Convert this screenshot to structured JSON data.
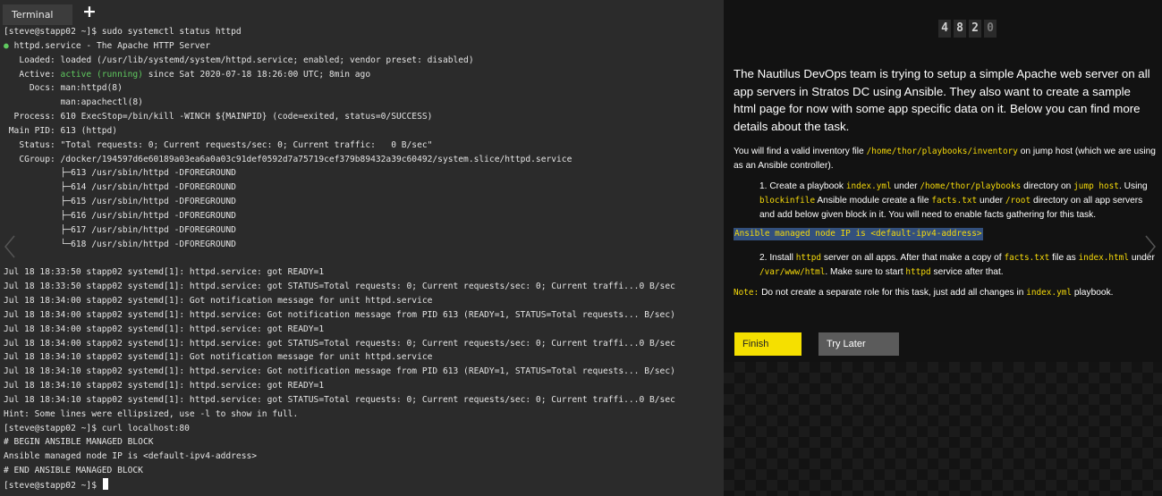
{
  "terminal": {
    "tab_label": "Terminal",
    "new_tab_icon": "plus-icon",
    "lines": [
      {
        "segments": [
          {
            "t": "[steve@stapp02 ~]$ sudo systemctl status httpd"
          }
        ]
      },
      {
        "segments": [
          {
            "t": "● ",
            "c": "green"
          },
          {
            "t": "httpd.service - The Apache HTTP Server"
          }
        ]
      },
      {
        "segments": [
          {
            "t": "   Loaded: loaded (/usr/lib/systemd/system/httpd.service; enabled; vendor preset: disabled)"
          }
        ]
      },
      {
        "segments": [
          {
            "t": "   Active: "
          },
          {
            "t": "active (running)",
            "c": "green"
          },
          {
            "t": " since Sat 2020-07-18 18:26:00 UTC; 8min ago"
          }
        ]
      },
      {
        "segments": [
          {
            "t": "     Docs: man:httpd(8)"
          }
        ]
      },
      {
        "segments": [
          {
            "t": "           man:apachectl(8)"
          }
        ]
      },
      {
        "segments": [
          {
            "t": "  Process: 610 ExecStop=/bin/kill -WINCH ${MAINPID} (code=exited, status=0/SUCCESS)"
          }
        ]
      },
      {
        "segments": [
          {
            "t": " Main PID: 613 (httpd)"
          }
        ]
      },
      {
        "segments": [
          {
            "t": "   Status: \"Total requests: 0; Current requests/sec: 0; Current traffic:   0 B/sec\""
          }
        ]
      },
      {
        "segments": [
          {
            "t": "   CGroup: /docker/194597d6e60189a03ea6a0a03c91def0592d7a75719cef379b89432a39c60492/system.slice/httpd.service"
          }
        ]
      },
      {
        "segments": [
          {
            "t": "           ├─613 /usr/sbin/httpd -DFOREGROUND"
          }
        ]
      },
      {
        "segments": [
          {
            "t": "           ├─614 /usr/sbin/httpd -DFOREGROUND"
          }
        ]
      },
      {
        "segments": [
          {
            "t": "           ├─615 /usr/sbin/httpd -DFOREGROUND"
          }
        ]
      },
      {
        "segments": [
          {
            "t": "           ├─616 /usr/sbin/httpd -DFOREGROUND"
          }
        ]
      },
      {
        "segments": [
          {
            "t": "           ├─617 /usr/sbin/httpd -DFOREGROUND"
          }
        ]
      },
      {
        "segments": [
          {
            "t": "           └─618 /usr/sbin/httpd -DFOREGROUND"
          }
        ]
      },
      {
        "segments": [
          {
            "t": ""
          }
        ]
      },
      {
        "segments": [
          {
            "t": "Jul 18 18:33:50 stapp02 systemd[1]: httpd.service: got READY=1"
          }
        ]
      },
      {
        "segments": [
          {
            "t": "Jul 18 18:33:50 stapp02 systemd[1]: httpd.service: got STATUS=Total requests: 0; Current requests/sec: 0; Current traffi...0 B/sec"
          }
        ]
      },
      {
        "segments": [
          {
            "t": "Jul 18 18:34:00 stapp02 systemd[1]: Got notification message for unit httpd.service"
          }
        ]
      },
      {
        "segments": [
          {
            "t": "Jul 18 18:34:00 stapp02 systemd[1]: httpd.service: Got notification message from PID 613 (READY=1, STATUS=Total requests... B/sec)"
          }
        ]
      },
      {
        "segments": [
          {
            "t": "Jul 18 18:34:00 stapp02 systemd[1]: httpd.service: got READY=1"
          }
        ]
      },
      {
        "segments": [
          {
            "t": "Jul 18 18:34:00 stapp02 systemd[1]: httpd.service: got STATUS=Total requests: 0; Current requests/sec: 0; Current traffi...0 B/sec"
          }
        ]
      },
      {
        "segments": [
          {
            "t": "Jul 18 18:34:10 stapp02 systemd[1]: Got notification message for unit httpd.service"
          }
        ]
      },
      {
        "segments": [
          {
            "t": "Jul 18 18:34:10 stapp02 systemd[1]: httpd.service: Got notification message from PID 613 (READY=1, STATUS=Total requests... B/sec)"
          }
        ]
      },
      {
        "segments": [
          {
            "t": "Jul 18 18:34:10 stapp02 systemd[1]: httpd.service: got READY=1"
          }
        ]
      },
      {
        "segments": [
          {
            "t": "Jul 18 18:34:10 stapp02 systemd[1]: httpd.service: got STATUS=Total requests: 0; Current requests/sec: 0; Current traffi...0 B/sec"
          }
        ]
      },
      {
        "segments": [
          {
            "t": "Hint: Some lines were ellipsized, use -l to show in full."
          }
        ]
      },
      {
        "segments": [
          {
            "t": "[steve@stapp02 ~]$ curl localhost:80"
          }
        ]
      },
      {
        "segments": [
          {
            "t": "# BEGIN ANSIBLE MANAGED BLOCK"
          }
        ]
      },
      {
        "segments": [
          {
            "t": "Ansible managed node IP is <default-ipv4-address>"
          }
        ]
      },
      {
        "segments": [
          {
            "t": "# END ANSIBLE MANAGED BLOCK"
          }
        ]
      },
      {
        "segments": [
          {
            "t": "[steve@stapp02 ~]$ "
          }
        ],
        "cursor": true
      }
    ]
  },
  "panel": {
    "timer_digits": [
      "4",
      "8",
      "2",
      "0"
    ],
    "intro": "The Nautilus DevOps team is trying to setup a simple Apache web server on all app servers in Stratos DC using Ansible. They also want to create a sample html page for now with some app specific data on it. Below you can find more details about the task.",
    "p1": {
      "a": "You will find a valid inventory file ",
      "code1": "/home/thor/playbooks/inventory",
      "b": " on jump host (which we are using as an Ansible controller)."
    },
    "li1": {
      "a": "1. Create a playbook ",
      "code1": "index.yml",
      "b": " under ",
      "code2": "/home/thor/playbooks",
      "c": " directory on ",
      "code3": "jump host",
      "d": ". Using ",
      "code4": "blockinfile",
      "e": " Ansible module create a file ",
      "code5": "facts.txt",
      "f": " under ",
      "code6": "/root",
      "g": " directory on all app servers and add below given block in it. You will need to enable facts gathering for this task."
    },
    "highlight": "Ansible managed node IP is <default-ipv4-address>",
    "li2": {
      "a": "2. Install ",
      "code1": "httpd",
      "b": " server on all apps. After that make a copy of ",
      "code2": "facts.txt",
      "c": " file as ",
      "code3": "index.html",
      "d": " under ",
      "code4": "/var/www/html",
      "e": ". Make sure to start ",
      "code5": "httpd",
      "f": " service after that."
    },
    "note": {
      "label": "Note:",
      "a": " Do not create a separate role for this task, just add all changes in ",
      "code1": "index.yml",
      "b": " playbook."
    },
    "finish_label": "Finish",
    "try_later_label": "Try Later",
    "colors": {
      "accent_yellow": "#f5e000",
      "highlight_bg": "#33507d",
      "code_yellow": "#f5d90a"
    }
  }
}
